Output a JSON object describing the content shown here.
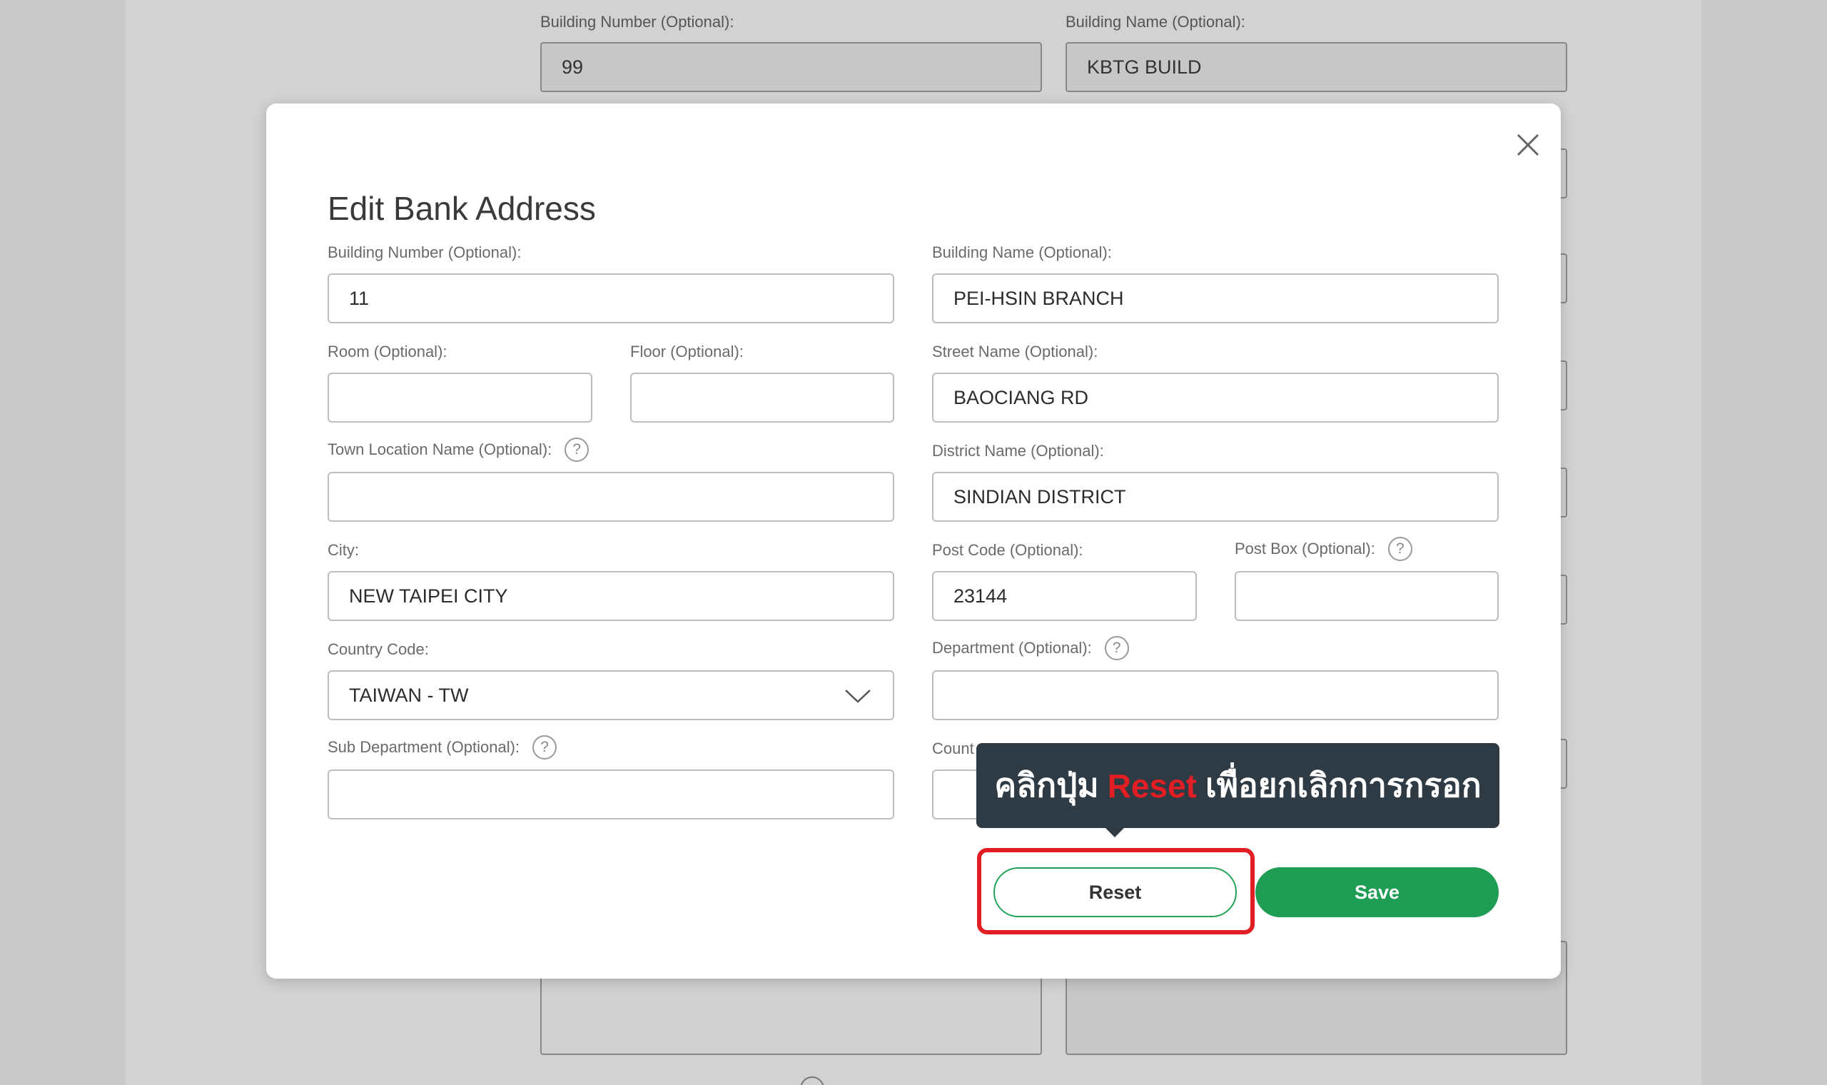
{
  "background": {
    "building_number_label": "Building Number (Optional):",
    "building_number_value": "99",
    "building_name_label": "Building Name (Optional):",
    "building_name_value": "KBTG BUILD"
  },
  "modal": {
    "title": "Edit Bank Address",
    "fields": {
      "building_number": {
        "label": "Building Number (Optional):",
        "value": "11"
      },
      "building_name": {
        "label": "Building Name (Optional):",
        "value": "PEI-HSIN BRANCH"
      },
      "room": {
        "label": "Room (Optional):",
        "value": ""
      },
      "floor": {
        "label": "Floor (Optional):",
        "value": ""
      },
      "street_name": {
        "label": "Street Name (Optional):",
        "value": "BAOCIANG RD"
      },
      "town_location": {
        "label": "Town Location Name (Optional):",
        "value": ""
      },
      "district_name": {
        "label": "District Name (Optional):",
        "value": "SINDIAN DISTRICT"
      },
      "city": {
        "label": "City:",
        "value": "NEW TAIPEI CITY"
      },
      "post_code": {
        "label": "Post Code (Optional):",
        "value": "23144"
      },
      "post_box": {
        "label": "Post Box (Optional):",
        "value": ""
      },
      "country_code": {
        "label": "Country Code:",
        "value": "TAIWAN - TW"
      },
      "department": {
        "label": "Department (Optional):",
        "value": ""
      },
      "sub_department": {
        "label": "Sub Department (Optional):",
        "value": ""
      },
      "country_sub_division": {
        "label": "Count",
        "value": ""
      }
    },
    "buttons": {
      "reset": "Reset",
      "save": "Save"
    },
    "help_glyph": "?"
  },
  "tooltip": {
    "before": "คลิกปุ่ม",
    "accent": "Reset",
    "after": "เพื่อยกเลิกการกรอก"
  },
  "colors": {
    "accent_green": "#1f9d55",
    "highlight_red": "#e21e25",
    "tooltip_bg": "#2f3b44"
  }
}
